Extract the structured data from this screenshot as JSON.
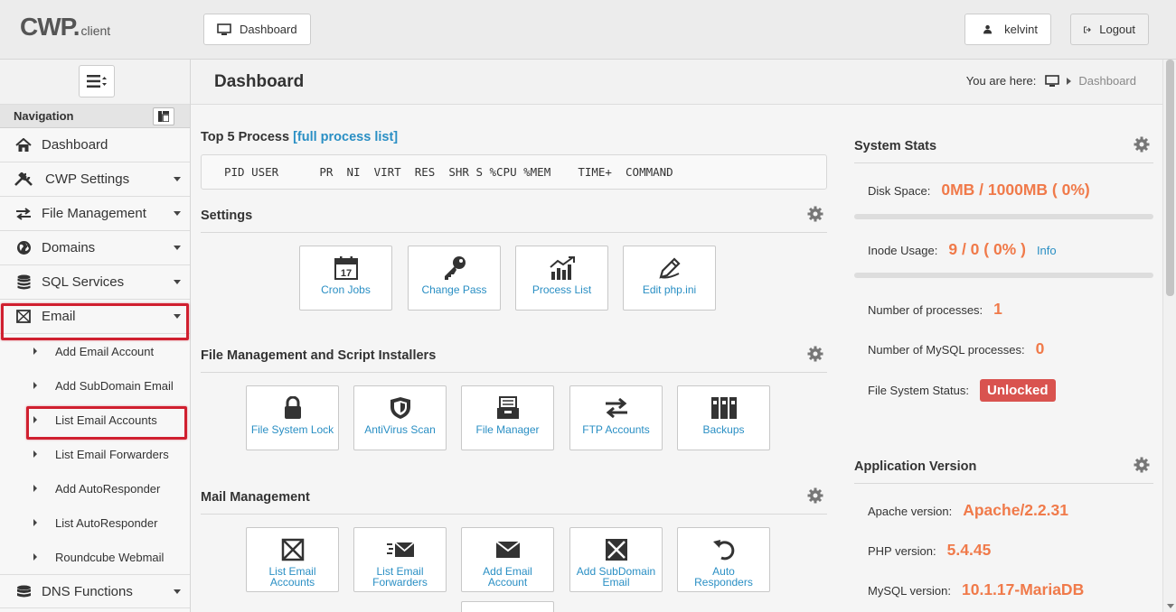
{
  "app": {
    "logo_main": "CWP",
    "logo_dot": ".",
    "logo_sub": "client"
  },
  "header": {
    "dashboard_button": "Dashboard",
    "user_name": "kelvint",
    "logout_label": "Logout"
  },
  "sidebar": {
    "navigation_label": "Navigation",
    "items": [
      {
        "label": "Dashboard",
        "icon": "home-icon"
      },
      {
        "label": "CWP Settings",
        "icon": "tools-icon"
      },
      {
        "label": "File Management",
        "icon": "transfer-icon"
      },
      {
        "label": "Domains",
        "icon": "globe-icon"
      },
      {
        "label": "SQL Services",
        "icon": "database-icon"
      },
      {
        "label": "Email",
        "icon": "envelope-icon"
      },
      {
        "label": "DNS Functions",
        "icon": "dns-icon"
      }
    ],
    "email_submenu": [
      "Add Email Account",
      "Add SubDomain Email",
      "List Email Accounts",
      "List Email Forwarders",
      "Add AutoResponder",
      "List AutoResponder",
      "Roundcube Webmail"
    ]
  },
  "content": {
    "title": "Dashboard",
    "breadcrumb_prefix": "You are here:",
    "breadcrumb_current": "Dashboard",
    "top_process": {
      "title": "Top 5 Process",
      "link": "[full process list]",
      "header_row": "PID USER      PR  NI  VIRT  RES  SHR S %CPU %MEM    TIME+  COMMAND"
    },
    "settings": {
      "title": "Settings",
      "tiles": [
        "Cron Jobs",
        "Change Pass",
        "Process List",
        "Edit php.ini"
      ]
    },
    "file_mgmt": {
      "title": "File Management and Script Installers",
      "tiles": [
        "File System Lock",
        "AntiVirus Scan",
        "File Manager",
        "FTP Accounts",
        "Backups"
      ]
    },
    "mail_mgmt": {
      "title": "Mail Management",
      "tiles": [
        [
          "List Email",
          "Accounts"
        ],
        [
          "List Email",
          "Forwarders"
        ],
        [
          "Add Email",
          "Account"
        ],
        [
          "Add SubDomain",
          "Email"
        ],
        [
          "Auto",
          "Responders"
        ]
      ]
    }
  },
  "system_stats": {
    "title": "System Stats",
    "disk_label": "Disk Space:",
    "disk_value": "0MB / 1000MB ( 0%)",
    "disk_fraction": 0,
    "inode_label": "Inode Usage:",
    "inode_value": "9 / 0 ( 0% )",
    "inode_link": "Info",
    "inode_fraction": 0,
    "processes_label": "Number of processes:",
    "processes_value": "1",
    "mysql_proc_label": "Number of MySQL processes:",
    "mysql_proc_value": "0",
    "fs_status_label": "File System Status:",
    "fs_status_value": "Unlocked"
  },
  "app_version": {
    "title": "Application Version",
    "apache_label": "Apache version:",
    "apache_value": "Apache/2.2.31",
    "php_label": "PHP version:",
    "php_value": "5.4.45",
    "mysql_label": "MySQL version:",
    "mysql_value": "10.1.17-MariaDB"
  },
  "colors": {
    "accent_link": "#2a8fc4",
    "stat_value": "#f07a4a",
    "danger": "#d9534f",
    "highlight_box": "#d01f2f"
  }
}
